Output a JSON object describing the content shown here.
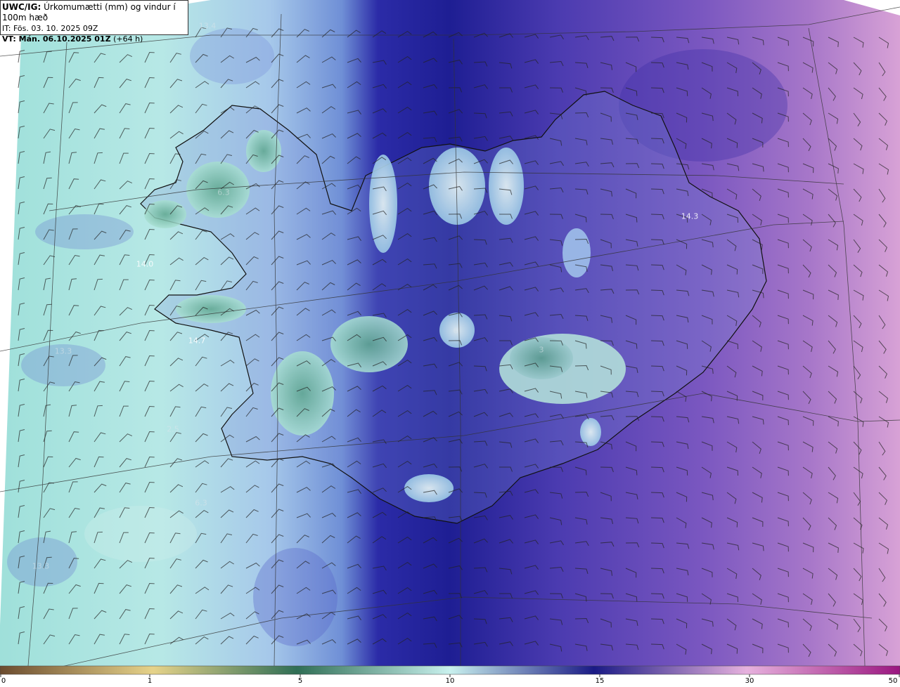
{
  "header": {
    "line1_bold": "UWC/IG:",
    "line1_rest": "Úrkomumætti (mm) og vindur í 100m hæð",
    "line2": "IT: Fös. 03. 10. 2025 09Z",
    "line3_bold": "VT: Mán. 06.10.2025 01Z",
    "line3_rest": "(+64 h)"
  },
  "map_labels": [
    {
      "text": "13.4",
      "style": "faint"
    },
    {
      "text": "6.3",
      "style": "faint"
    },
    {
      "text": "14.0",
      "style": "normal"
    },
    {
      "text": "14.7",
      "style": "normal"
    },
    {
      "text": "13.3",
      "style": "faint"
    },
    {
      "text": "2.5",
      "style": "faint"
    },
    {
      "text": "6.3",
      "style": "faint"
    },
    {
      "text": "13.3",
      "style": "faint"
    },
    {
      "text": "14.3",
      "style": "normal"
    },
    {
      "text": "6",
      "style": "faint"
    },
    {
      "text": "3",
      "style": "faint"
    }
  ],
  "colorbar": {
    "ticks": [
      "0",
      "1",
      "5",
      "10",
      "15",
      "30",
      "50"
    ],
    "stops": [
      {
        "value": 0,
        "color": "#7a5a3a"
      },
      {
        "value": 1,
        "color": "#e8d98a"
      },
      {
        "value": 5,
        "color": "#2f7a5a"
      },
      {
        "value": 10,
        "color": "#c9f2ef"
      },
      {
        "value": 15,
        "color": "#1f1f8e"
      },
      {
        "value": 30,
        "color": "#e3a6d8"
      },
      {
        "value": 50,
        "color": "#9a1a8a"
      }
    ]
  },
  "colors": {
    "low_field": "#a9e3dc",
    "mid_field": "#7ca8d8",
    "high_field": "#2a2aa0",
    "east_field": "#8a63c6",
    "far_east_field": "#d7a6db",
    "land_green": "#6ab59a",
    "coast": "#111111"
  }
}
